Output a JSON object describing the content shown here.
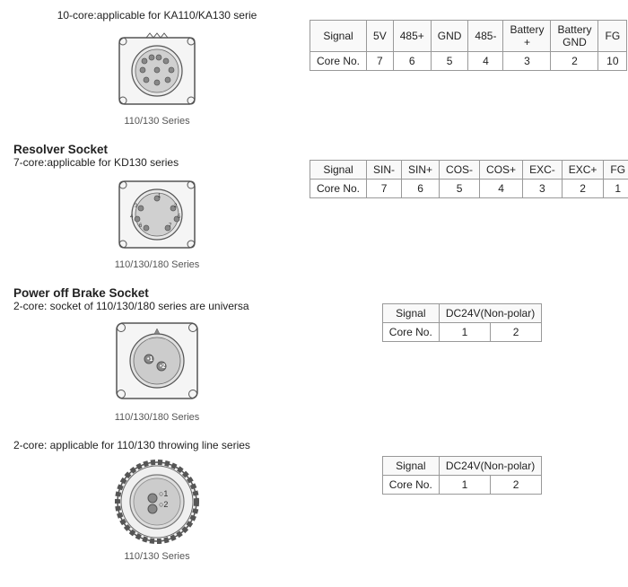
{
  "sections": [
    {
      "id": "encoder-socket",
      "top_desc": "10-core:applicable for KA110/KA130 serie",
      "connector_caption": "110/130 Series",
      "table": {
        "headers": [
          "Signal",
          "5V",
          "485+",
          "GND",
          "485-",
          "Battery\n+",
          "Battery\nGND",
          "FG"
        ],
        "row": [
          "Core No.",
          "7",
          "6",
          "5",
          "4",
          "3",
          "2",
          "10"
        ]
      }
    },
    {
      "id": "resolver-socket",
      "title": "Resolver Socket",
      "subtitle": "7-core:applicable for KD130 series",
      "connector_caption": "110/130/180 Series",
      "table": {
        "headers": [
          "Signal",
          "SIN-",
          "SIN+",
          "COS-",
          "COS+",
          "EXC-",
          "EXC+",
          "FG"
        ],
        "row": [
          "Core No.",
          "7",
          "6",
          "5",
          "4",
          "3",
          "2",
          "1"
        ]
      }
    },
    {
      "id": "power-off-brake-socket",
      "title": "Power off Brake Socket",
      "subtitle": "2-core: socket of 110/130/180 series are universa",
      "connector_caption": "110/130/180 Series",
      "table": {
        "headers": [
          "Signal",
          "DC24V(Non-polar)"
        ],
        "sub_headers": [
          "",
          "1",
          "2"
        ],
        "rows": [
          [
            "Signal",
            "DC24V(Non-polar)",
            ""
          ],
          [
            "Core No.",
            "1",
            "2"
          ]
        ]
      }
    },
    {
      "id": "power-off-brake-socket-2",
      "subtitle": "2-core: applicable for 110/130 throwing line series",
      "connector_caption": "110/130 Series",
      "table": {
        "rows": [
          [
            "Signal",
            "DC24V(Non-polar)",
            ""
          ],
          [
            "Core No.",
            "1",
            "2"
          ]
        ]
      }
    }
  ],
  "labels": {
    "signal": "Signal",
    "core_no": "Core No.",
    "dc24v": "DC24V(Non-polar)",
    "battery_plus": "Battery +",
    "battery_gnd": "Battery GND"
  }
}
